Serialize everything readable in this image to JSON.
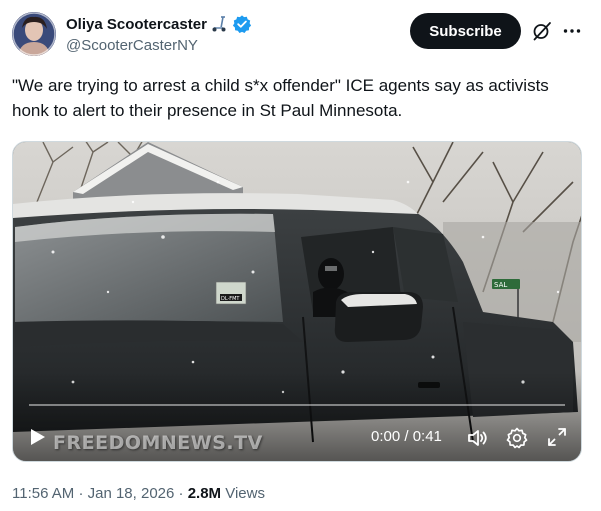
{
  "author": {
    "display_name": "Oliya Scootercaster",
    "handle": "@ScooterCasterNY",
    "emoji_icon": "kick-scooter-icon",
    "verified_icon": "verified-badge-icon",
    "verified_color": "#1d9bf0"
  },
  "header": {
    "subscribe_label": "Subscribe",
    "grok_icon": "grok-icon",
    "more_icon": "more-icon"
  },
  "tweet": {
    "text": "\"We are trying to arrest a child s*x offender\" ICE agents say as activists honk to alert to their presence in St Paul Minnesota."
  },
  "media": {
    "watermark": "FREEDOMNEWS.TV",
    "time_display": "0:00 / 0:41",
    "progress": 0,
    "play_icon": "play-icon",
    "volume_icon": "volume-icon",
    "settings_icon": "settings-icon",
    "fullscreen_icon": "fullscreen-icon",
    "plate_text": "DL·FMT",
    "sign_text": "SAL"
  },
  "meta": {
    "time": "11:56 AM",
    "separator": "·",
    "date": "Jan 18, 2026",
    "views_count": "2.8M",
    "views_label": "Views"
  },
  "colors": {
    "text_primary": "#0f1419",
    "text_secondary": "#536471",
    "button_dark": "#0f1419",
    "border": "#cfd9de"
  }
}
